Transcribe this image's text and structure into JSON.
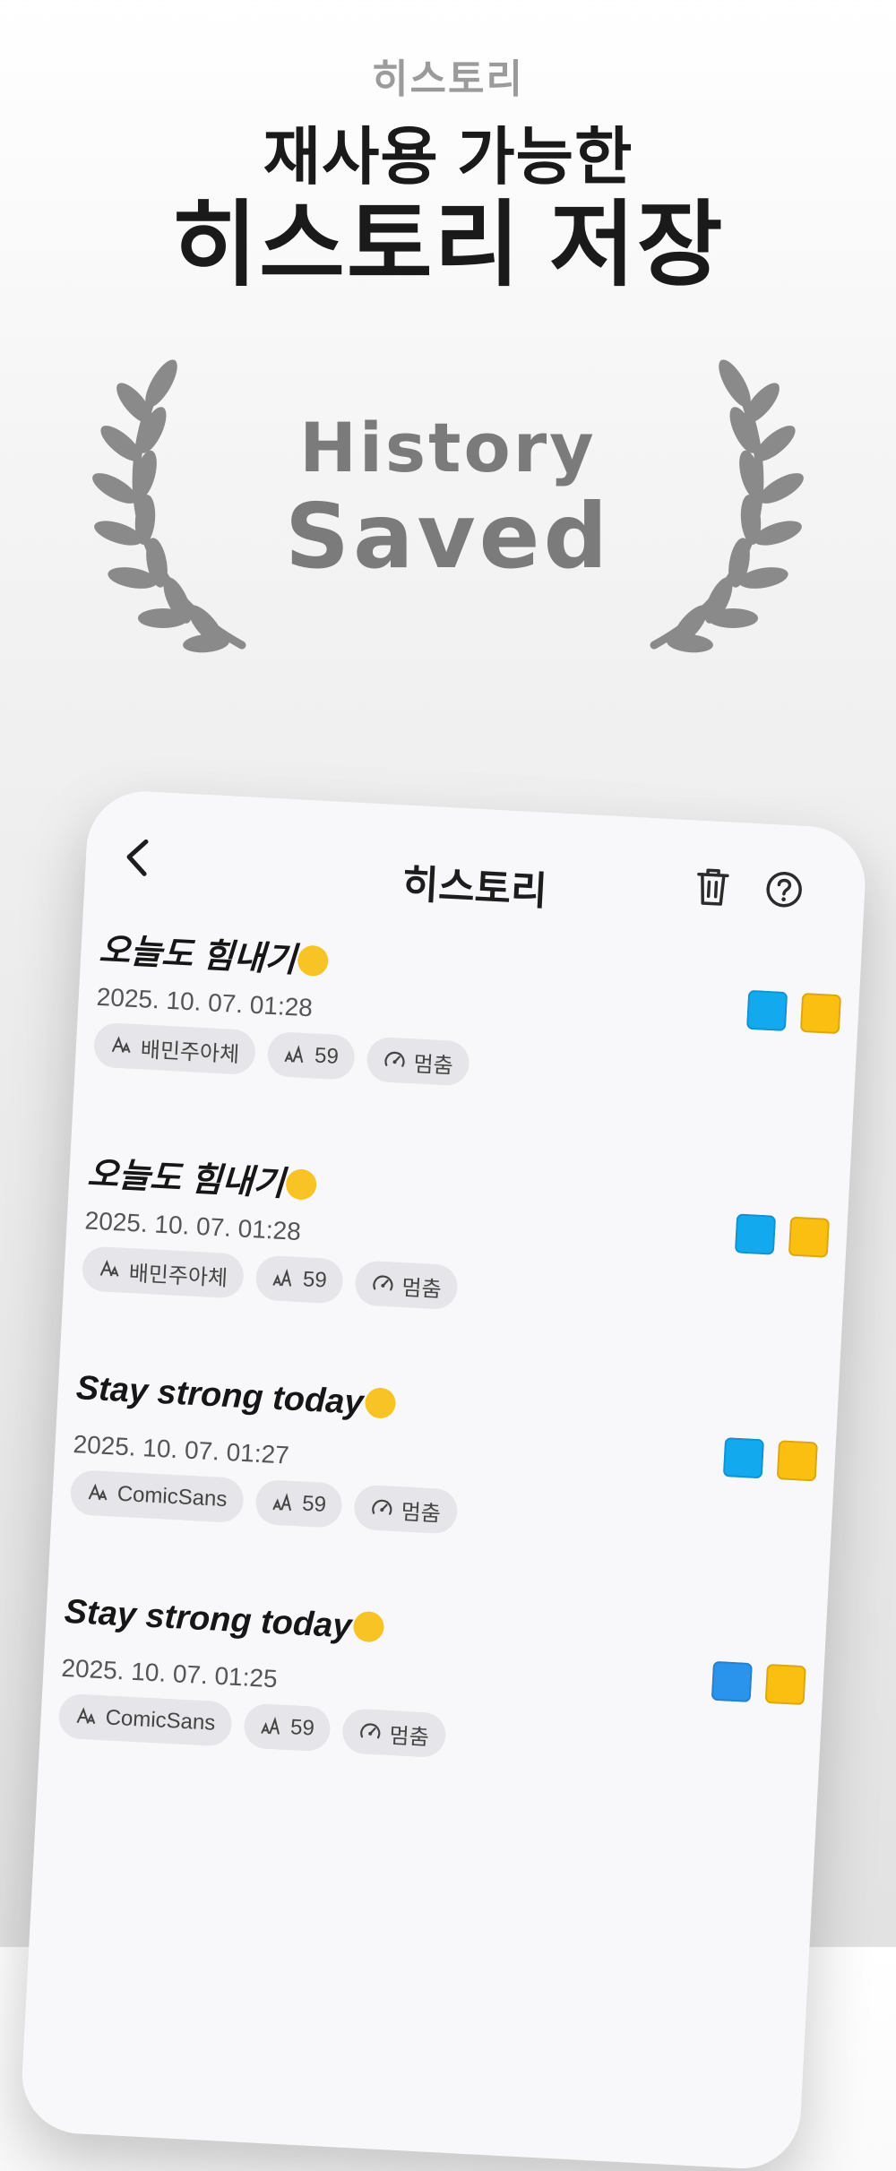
{
  "promo": {
    "subtitle": "히스토리",
    "title_line1": "재사용 가능한",
    "title_line2": "히스토리 저장",
    "badge_line1": "History",
    "badge_line2": "Saved"
  },
  "screen": {
    "title": "히스토리",
    "back_icon": "chevron-left-icon",
    "trash_icon": "trash-icon",
    "help_icon": "help-circle-icon"
  },
  "items": [
    {
      "text": "오늘도 힘내기",
      "date": "2025. 10. 07. 01:28",
      "font": "배민주아체",
      "size": "59",
      "motion": "멈춤",
      "colors": [
        "#12a9ee",
        "#fbbf12"
      ]
    },
    {
      "text": "오늘도 힘내기",
      "date": "2025. 10. 07. 01:28",
      "font": "배민주아체",
      "size": "59",
      "motion": "멈춤",
      "colors": [
        "#12a9ee",
        "#fbbf12"
      ]
    },
    {
      "text": "Stay strong today",
      "date": "2025. 10. 07. 01:27",
      "font": "ComicSans",
      "size": "59",
      "motion": "멈춤",
      "colors": [
        "#12a9ee",
        "#fbbf12"
      ]
    },
    {
      "text": "Stay strong today",
      "date": "2025. 10. 07. 01:25",
      "font": "ComicSans",
      "size": "59",
      "motion": "멈춤",
      "colors": [
        "#2a93ec",
        "#fbbf12"
      ]
    }
  ]
}
